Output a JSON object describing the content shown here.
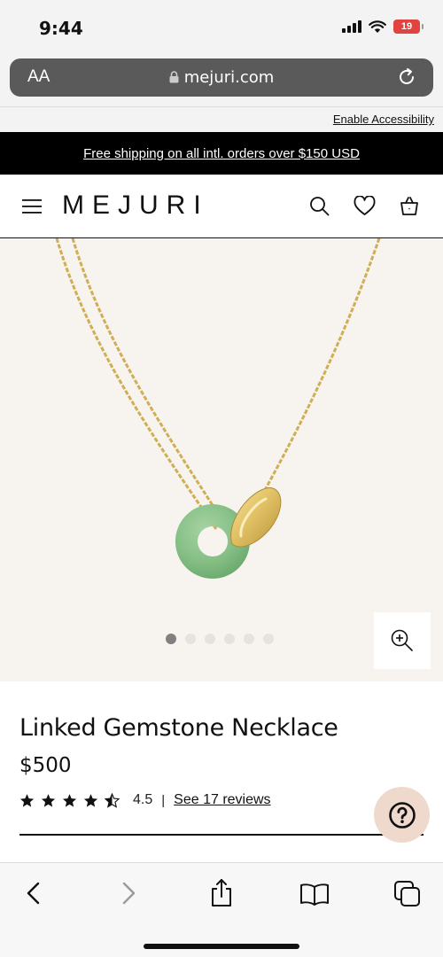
{
  "status_bar": {
    "time": "9:44",
    "battery": "19"
  },
  "browser": {
    "text_size_label": "AA",
    "url": "mejuri.com"
  },
  "accessibility": {
    "link": "Enable Accessibility"
  },
  "promo": {
    "text": "Free shipping on all intl. orders over $150 USD"
  },
  "header": {
    "logo": "MEJURI"
  },
  "gallery": {
    "image_count": 6,
    "active_index": 0
  },
  "product": {
    "title": "Linked Gemstone Necklace",
    "price": "$500",
    "rating": "4.5",
    "rating_value": 4.5,
    "separator": "|",
    "reviews_link": "See 17 reviews"
  },
  "colors": {
    "promo_bg": "#000000",
    "gallery_bg": "#f7f4ef",
    "help_bg": "#efd9cd",
    "jade": "#8fc48f",
    "gold": "#e0c266"
  },
  "icons": [
    "signal-icon",
    "wifi-icon",
    "battery-icon",
    "lock-icon",
    "reload-icon",
    "menu-icon",
    "search-icon",
    "heart-icon",
    "bag-icon",
    "zoom-in-icon",
    "star-icon",
    "help-icon",
    "back-icon",
    "forward-icon",
    "share-icon",
    "bookmarks-icon",
    "tabs-icon"
  ]
}
